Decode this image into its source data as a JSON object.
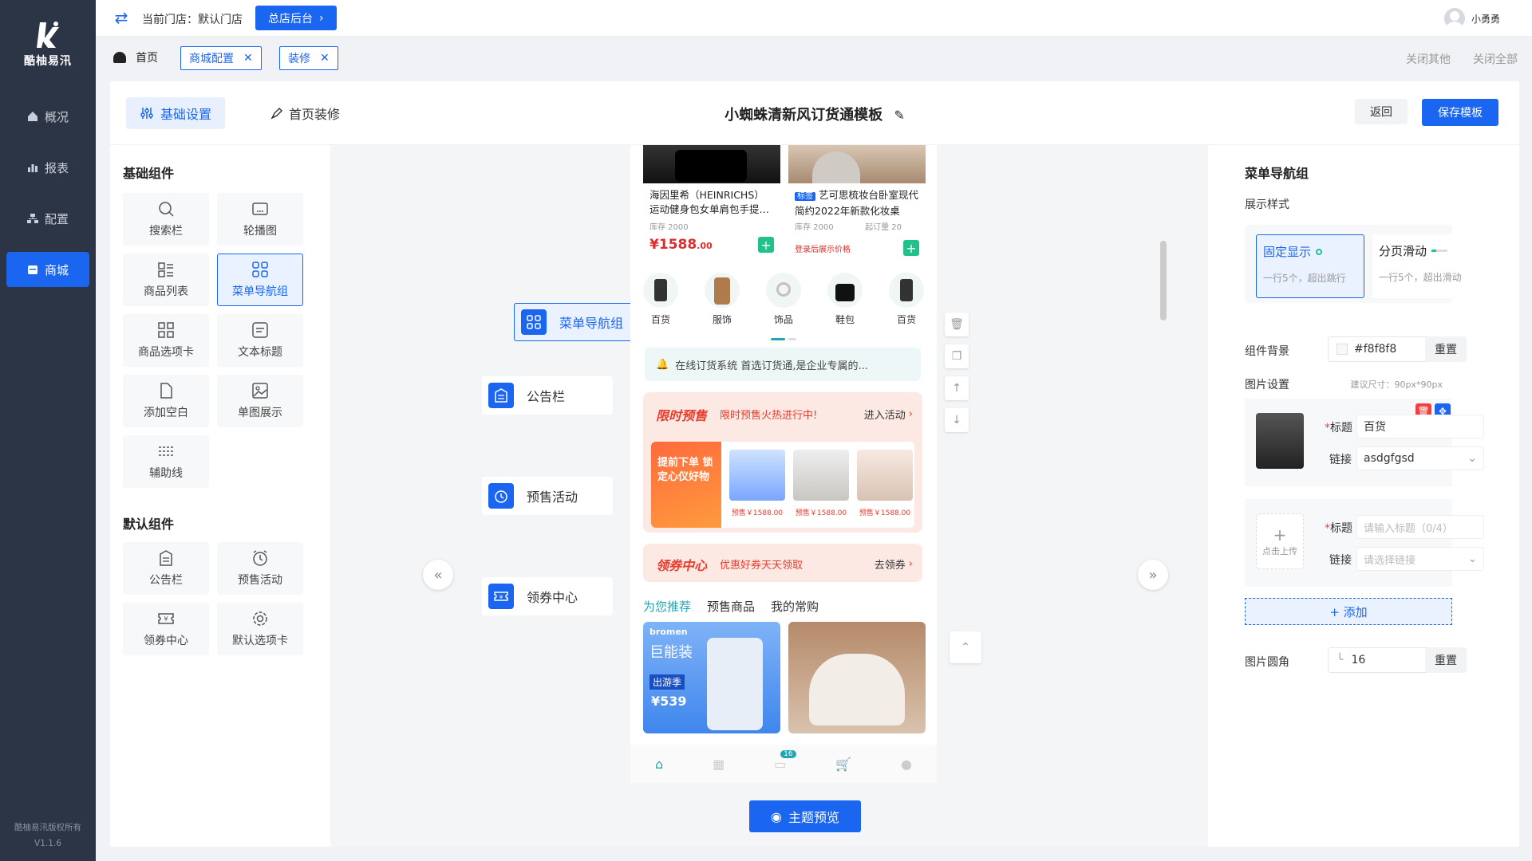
{
  "brand": {
    "name": "酷柚易汛",
    "copyright": "酷柚易汛版权所有",
    "version": "V1.1.6"
  },
  "sidebar": {
    "items": [
      {
        "label": "概况",
        "icon": "home-icon"
      },
      {
        "label": "报表",
        "icon": "chart-icon"
      },
      {
        "label": "配置",
        "icon": "config-icon"
      },
      {
        "label": "商城",
        "icon": "store-icon"
      }
    ]
  },
  "topbar": {
    "store_label": "当前门店：默认门店",
    "hq_button": "总店后台",
    "username": "小勇勇"
  },
  "tags": {
    "home": "首页",
    "items": [
      "商城配置",
      "装修"
    ],
    "close_others": "关闭其他",
    "close_all": "关闭全部"
  },
  "editor": {
    "tabs": {
      "basic": "基础设置",
      "decor": "首页装修"
    },
    "title": "小蜘蛛清新风订货通模板",
    "back": "返回",
    "save": "保存模板",
    "preview": "主题预览"
  },
  "palette": {
    "basic_title": "基础组件",
    "basic": [
      "搜索栏",
      "轮播图",
      "商品列表",
      "菜单导航组",
      "商品选项卡",
      "文本标题",
      "添加空白",
      "单图展示",
      "辅助线"
    ],
    "default_title": "默认组件",
    "defaults": [
      "公告栏",
      "预售活动",
      "领券中心",
      "默认选项卡"
    ]
  },
  "canvas": {
    "components": [
      "菜单导航组",
      "公告栏",
      "预售活动",
      "领券中心"
    ]
  },
  "phone": {
    "products": [
      {
        "name": "海因里希（HEINRICHS）运动健身包女单肩包手提…",
        "stock": "库存 2000",
        "price": "1588",
        "price_decimal": ".00"
      },
      {
        "tag": "标签",
        "name": "艺可思梳妆台卧室现代简约2022年新款化妆桌",
        "stock": "库存 2000",
        "min": "起订量 20",
        "login_hint": "登录后展示价格"
      }
    ],
    "menu": [
      "百货",
      "服饰",
      "饰品",
      "鞋包",
      "百货"
    ],
    "notice": "在线订货系统 首选订货通,是企业专属的...",
    "presale": {
      "title": "限时预售",
      "sub": "限时预售火热进行中!",
      "action": "进入活动",
      "promo": "提前下单 锁定心仪好物",
      "prices": [
        "预售￥1588.00",
        "预售￥1588.00",
        "预售￥1588.00"
      ]
    },
    "coupon": {
      "title": "领券中心",
      "sub": "优惠好券天天领取",
      "action": "去领券"
    },
    "tabs": [
      "为您推荐",
      "预售商品",
      "我的常购"
    ],
    "banner": {
      "brand": "bromen",
      "headline": "巨能装",
      "tag": "出游季",
      "price": "539"
    },
    "badge": "16"
  },
  "panel": {
    "title": "菜单导航组",
    "style_label": "展示样式",
    "styles": [
      {
        "name": "固定显示",
        "desc": "一行5个，超出跳行"
      },
      {
        "name": "分页滑动",
        "desc": "一行5个，超出滑动"
      }
    ],
    "bg_label": "组件背景",
    "bg_value": "#f8f8f8",
    "reset": "重置",
    "img_label": "图片设置",
    "img_hint": "建议尺寸：90px*90px",
    "item1": {
      "title_label": "标题",
      "title_value": "百货",
      "link_label": "链接",
      "link_value": "asdgfgsd"
    },
    "item2": {
      "title_label": "标题",
      "title_placeholder": "请输入标题（0/4）",
      "link_label": "链接",
      "link_placeholder": "请选择链接",
      "upload": "点击上传"
    },
    "add": "+ 添加",
    "radius_label": "图片圆角",
    "radius_value": "16",
    "accent": "#1a66f0"
  }
}
